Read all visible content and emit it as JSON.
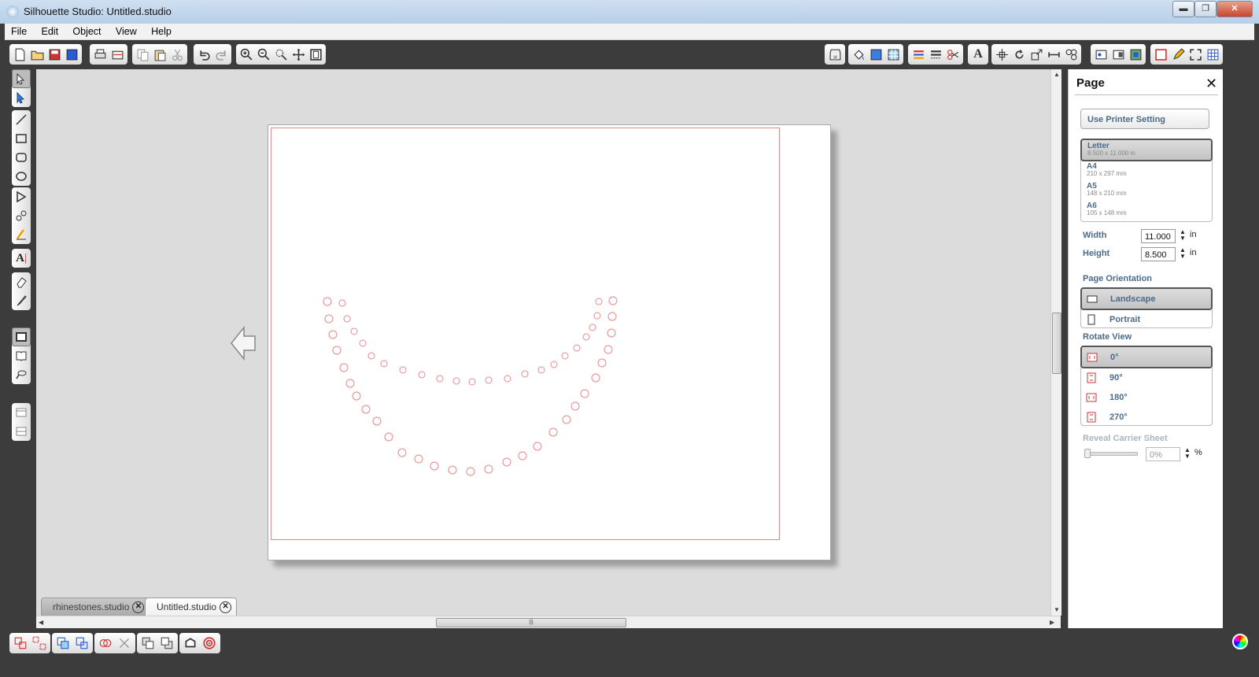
{
  "window": {
    "title": "Silhouette Studio: Untitled.studio",
    "minimize": "▬",
    "maximize": "❐",
    "close": "✕"
  },
  "menu": [
    "File",
    "Edit",
    "Object",
    "View",
    "Help"
  ],
  "tabs": [
    {
      "label": "rhinestones.studio",
      "close": "✕"
    },
    {
      "label": "Untitled.studio",
      "close": "✕"
    }
  ],
  "colors": {
    "cut_line": "#e58a8a",
    "accent_text": "#4a6a8a",
    "chrome": "#3c3c3c"
  },
  "panel": {
    "title": "Page",
    "close": "✕",
    "use_printer_setting": "Use Printer Setting",
    "page_sizes": [
      {
        "name": "Letter",
        "dims": "8.500 x 11.000 in",
        "selected": true
      },
      {
        "name": "A4",
        "dims": "210 x 297 mm",
        "selected": false
      },
      {
        "name": "A5",
        "dims": "148 x 210 mm",
        "selected": false
      },
      {
        "name": "A6",
        "dims": "105 x 148 mm",
        "selected": false
      }
    ],
    "width_label": "Width",
    "width_value": "11.000",
    "width_unit": "in",
    "height_label": "Height",
    "height_value": "8.500",
    "height_unit": "in",
    "orientation_label": "Page Orientation",
    "orientations": [
      {
        "label": "Landscape",
        "selected": true
      },
      {
        "label": "Portrait",
        "selected": false
      }
    ],
    "rotate_label": "Rotate View",
    "rotations": [
      {
        "label": "0°",
        "selected": true
      },
      {
        "label": "90°",
        "selected": false
      },
      {
        "label": "180°",
        "selected": false
      },
      {
        "label": "270°",
        "selected": false
      }
    ],
    "reveal_label": "Reveal Carrier Sheet",
    "reveal_value": "0%",
    "reveal_unit": "%"
  },
  "scrollbar": {
    "grip": "|||"
  }
}
